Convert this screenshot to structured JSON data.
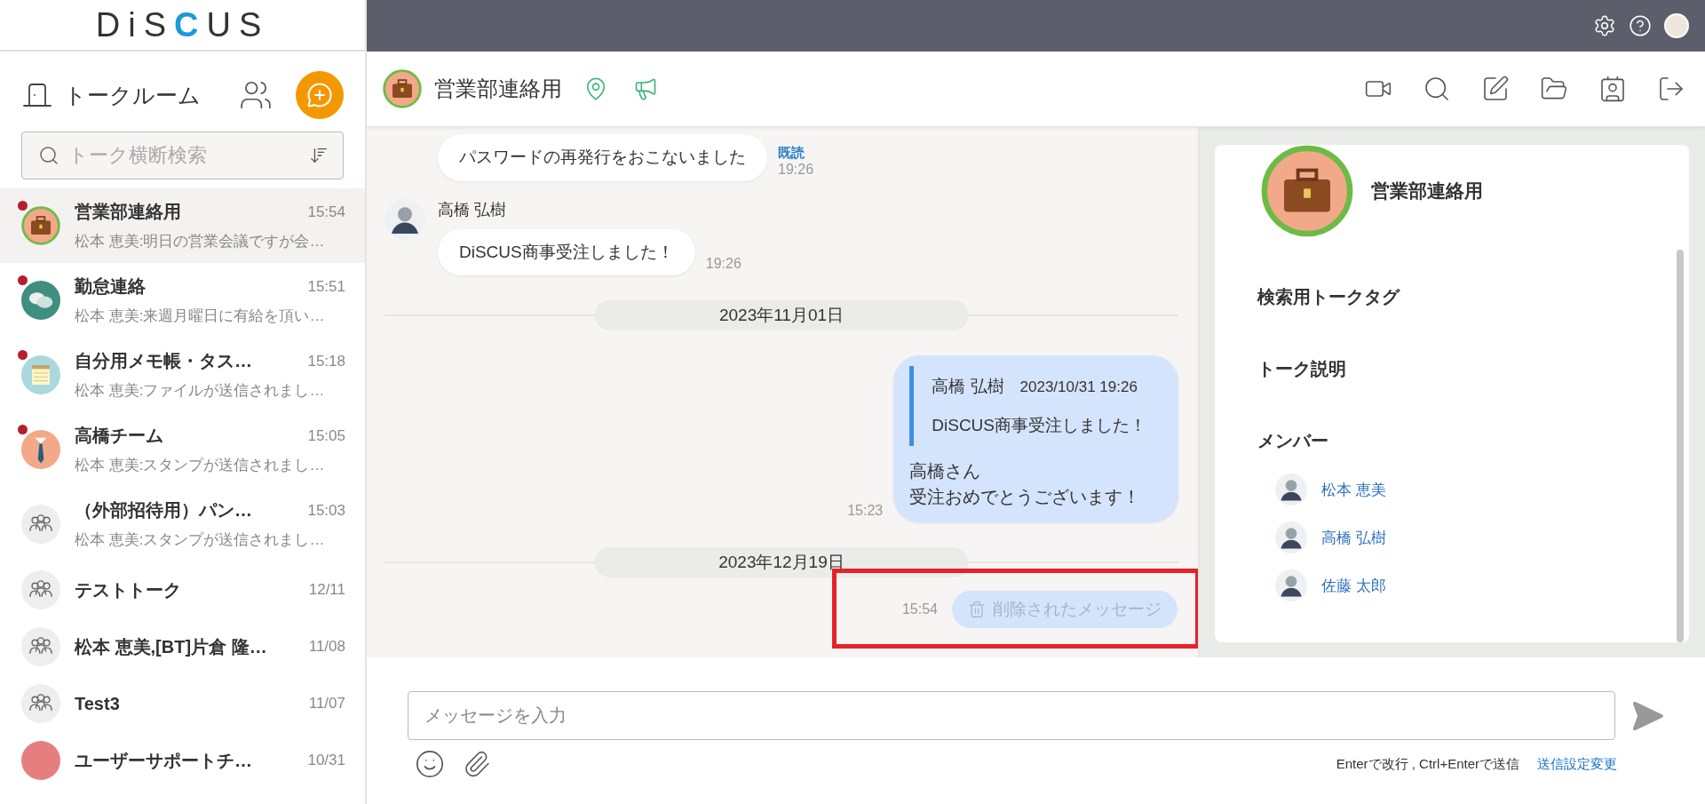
{
  "logo": "DiSCUS",
  "sidebar": {
    "title": "トークルーム",
    "search": {
      "placeholder": "トーク横断検索"
    },
    "rooms": [
      {
        "name": "営業部連絡用",
        "time": "15:54",
        "preview": "松本 恵美:明日の営業会議ですが会…",
        "kind": "briefcase",
        "color": "#f2a98a",
        "unread": true,
        "selected": true
      },
      {
        "name": "勤怠連絡",
        "time": "15:51",
        "preview": "松本 恵美:来週月曜日に有給を頂い…",
        "kind": "chat",
        "color": "#3e8f80",
        "unread": true,
        "selected": false
      },
      {
        "name": "自分用メモ帳・タス…",
        "time": "15:18",
        "preview": "松本 恵美:ファイルが送信されまし…",
        "kind": "memo",
        "color": "#a9d9dd",
        "unread": true,
        "selected": false
      },
      {
        "name": "高橋チーム",
        "time": "15:05",
        "preview": "松本 恵美:スタンプが送信されまし…",
        "kind": "tie",
        "color": "#f2a98a",
        "unread": true,
        "selected": false
      },
      {
        "name": "（外部招待用）パン…",
        "time": "15:03",
        "preview": "松本 恵美:スタンプが送信されまし…",
        "kind": "group",
        "color": "#eeeeee",
        "unread": false,
        "selected": false
      },
      {
        "name": "テストトーク",
        "time": "12/11",
        "kind": "group",
        "color": "#eeeeee",
        "unread": false,
        "selected": false
      },
      {
        "name": "松本 恵美,[BT]片倉 隆…",
        "time": "11/08",
        "kind": "group",
        "color": "#eeeeee",
        "unread": false,
        "selected": false
      },
      {
        "name": "Test3",
        "time": "11/07",
        "kind": "group",
        "color": "#eeeeee",
        "unread": false,
        "selected": false
      },
      {
        "name": "ユーザーサポートチ…",
        "time": "10/31",
        "kind": "plain",
        "color": "#e57f7f",
        "unread": false,
        "selected": false
      }
    ]
  },
  "chat": {
    "title": "営業部連絡用",
    "messages": [
      {
        "kind": "text",
        "text": "パスワードの再発行をおこないました",
        "time": "19:26",
        "status": "既読"
      },
      {
        "kind": "text",
        "sender": "高橋 弘樹",
        "text": "DiSCUS商事受注しました！",
        "time": "19:26"
      },
      {
        "kind": "date",
        "text": "2023年11月01日"
      },
      {
        "kind": "reply",
        "quote_sender": "高橋 弘樹",
        "quote_time": "2023/10/31 19:26",
        "quote_text": "DiSCUS商事受注しました！",
        "lines": [
          "高橋さん",
          "受注おめでとうございます！"
        ],
        "time": "15:23"
      },
      {
        "kind": "date",
        "text": "2023年12月19日"
      },
      {
        "kind": "deleted",
        "text": "削除されたメッセージ",
        "time": "15:54",
        "highlighted": true
      }
    ]
  },
  "composer": {
    "placeholder": "メッセージを入力",
    "hint": "Enterで改行 , Ctrl+Enterで送信",
    "settings_link": "送信設定変更"
  },
  "info": {
    "title": "営業部連絡用",
    "sections": [
      "検索用トークタグ",
      "トーク説明"
    ],
    "members_title": "メンバー",
    "members": [
      "松本 恵美",
      "高橋 弘樹",
      "佐藤 太郎"
    ]
  }
}
